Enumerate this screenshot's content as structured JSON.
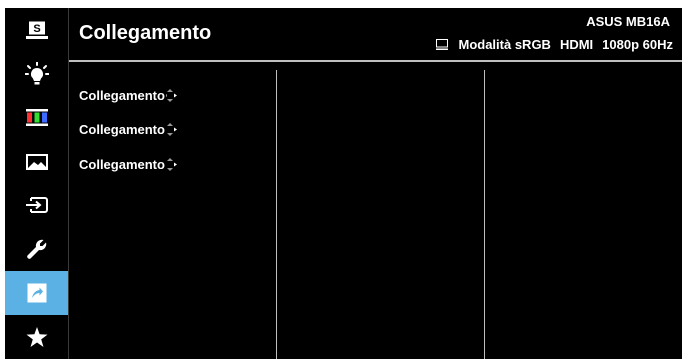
{
  "header": {
    "title": "Collegamento",
    "model": "ASUS MB16A",
    "mode": "Modalità sRGB",
    "input": "HDMI",
    "resolution": "1080p 60Hz"
  },
  "sidebar": {
    "items": [
      {
        "icon": "splendid-icon",
        "active": false
      },
      {
        "icon": "blue-light-icon",
        "active": false
      },
      {
        "icon": "color-bars-icon",
        "active": false
      },
      {
        "icon": "image-icon",
        "active": false
      },
      {
        "icon": "input-select-icon",
        "active": false
      },
      {
        "icon": "wrench-icon",
        "active": false
      },
      {
        "icon": "shortcut-icon",
        "active": true
      },
      {
        "icon": "star-icon",
        "active": false
      }
    ],
    "active_color": "#5bb1e3"
  },
  "menu": {
    "items": [
      {
        "label": "Collegamento"
      },
      {
        "label": "Collegamento"
      },
      {
        "label": "Collegamento"
      }
    ]
  }
}
